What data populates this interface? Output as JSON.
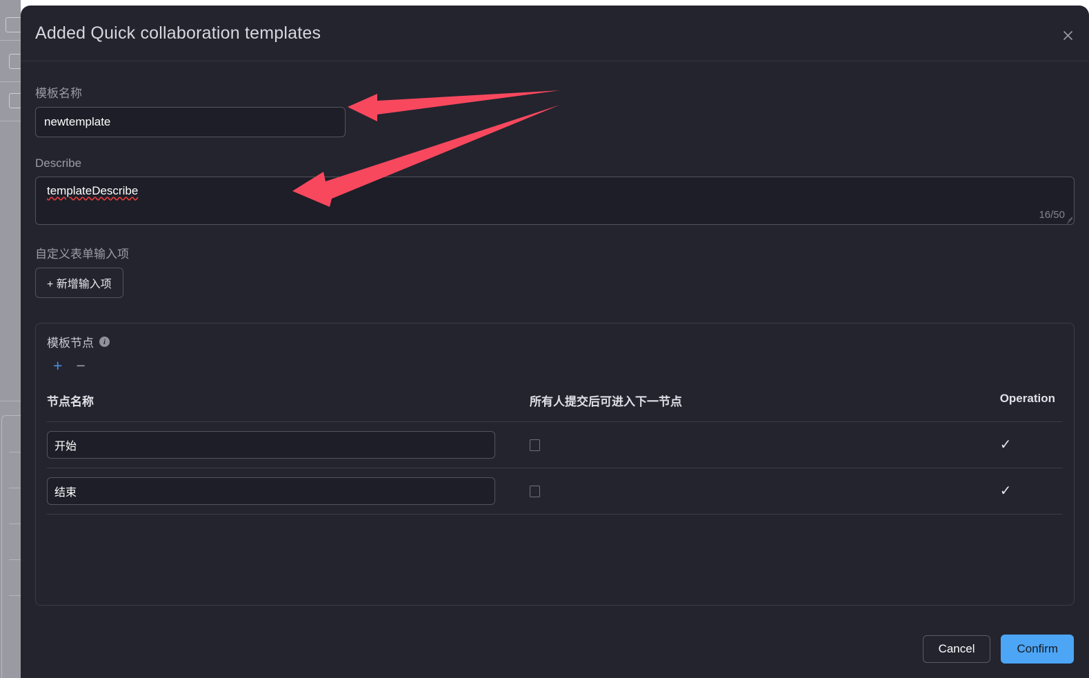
{
  "dialog": {
    "title": "Added Quick collaboration templates",
    "close_icon": "close-icon"
  },
  "form": {
    "name_label": "模板名称",
    "name_value": "newtemplate",
    "describe_label": "Describe",
    "describe_value": "templateDescribe",
    "describe_counter": "16/50",
    "custom_fields_label": "自定义表单输入项",
    "add_input_button": "+ 新增输入项"
  },
  "node_panel": {
    "title": "模板节点",
    "info_icon": "info-icon",
    "add_icon": "+",
    "remove_icon": "−",
    "columns": [
      "节点名称",
      "所有人提交后可进入下一节点",
      "Operation"
    ],
    "rows": [
      {
        "name": "开始",
        "checked": false,
        "operation_icon": "check-icon"
      },
      {
        "name": "结束",
        "checked": false,
        "operation_icon": "check-icon"
      }
    ]
  },
  "footer": {
    "cancel_label": "Cancel",
    "confirm_label": "Confirm"
  },
  "colors": {
    "dialog_bg": "#23242e",
    "input_bg": "#1d1e27",
    "border": "#53545e",
    "accent_blue": "#4ca5f5",
    "annotation_red": "#f8485e",
    "muted_text": "#9a9ca6"
  },
  "annotations": {
    "arrow_1": "red-arrow-pointing-to-name-input",
    "arrow_2": "red-arrow-pointing-to-describe-textarea"
  }
}
